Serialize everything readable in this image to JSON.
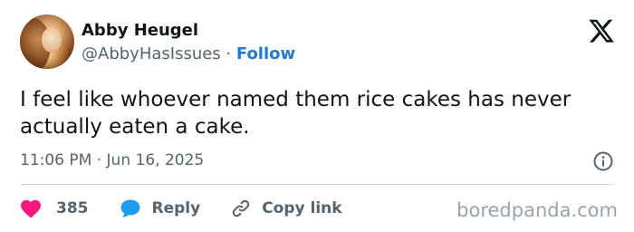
{
  "author": {
    "display_name": "Abby Heugel",
    "handle": "@AbbyHasIssues",
    "separator": "·",
    "follow_label": "Follow"
  },
  "tweet": {
    "text": "I feel like whoever named them rice cakes has never actually eaten a cake.",
    "time": "11:06 PM",
    "date_separator": "·",
    "date": "Jun 16, 2025"
  },
  "actions": {
    "like_count": "385",
    "reply_label": "Reply",
    "copy_link_label": "Copy link"
  },
  "watermark": "boredpanda.com",
  "icons": {
    "brand": "x-logo-icon",
    "info": "info-icon",
    "like": "heart-icon",
    "reply": "speech-bubble-icon",
    "copy": "link-icon"
  },
  "colors": {
    "like": "#f91880",
    "reply": "#1d9bf0",
    "follow": "#1d7bd8",
    "muted": "#536471",
    "text": "#0f1419"
  }
}
